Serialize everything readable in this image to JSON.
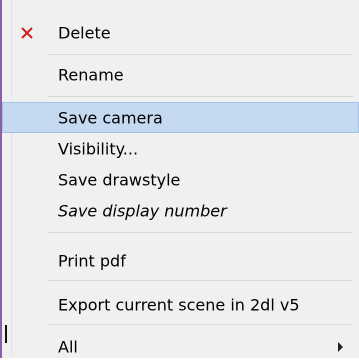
{
  "menu": {
    "items": [
      {
        "id": "delete",
        "label": "Delete",
        "icon": "close-icon",
        "icon_color": "#d21f1f"
      },
      {
        "id": "rename",
        "label": "Rename"
      },
      {
        "id": "save_camera",
        "label": "Save camera",
        "highlighted": true,
        "highlight_color": "#c5d9f1"
      },
      {
        "id": "visibility",
        "label": "Visibility..."
      },
      {
        "id": "save_drawstyle",
        "label": "Save drawstyle"
      },
      {
        "id": "save_display_number",
        "label": "Save display number",
        "italic": true
      },
      {
        "id": "print_pdf",
        "label": "Print pdf"
      },
      {
        "id": "export_scene",
        "label": "Export current scene in 2dl v5"
      },
      {
        "id": "all",
        "label": "All",
        "has_submenu": true
      }
    ]
  }
}
